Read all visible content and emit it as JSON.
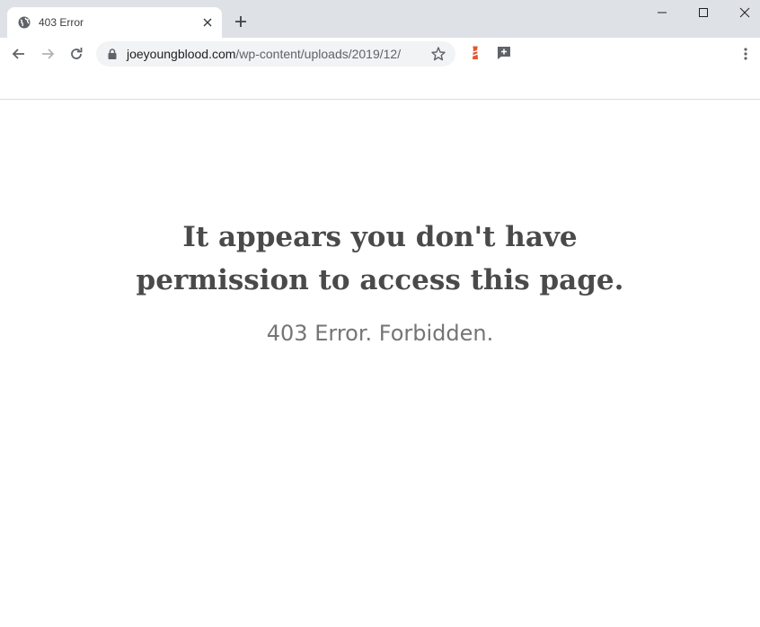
{
  "browser": {
    "tab": {
      "title": "403 Error",
      "favicon": "globe-icon"
    },
    "url": {
      "domain": "joeyoungblood.com",
      "path": "/wp-content/uploads/2019/12/"
    },
    "extensions": [
      {
        "name": "lighthouse-extension-icon",
        "color": "#e4572e"
      },
      {
        "name": "add-comment-extension-icon",
        "color": "#5f6368"
      }
    ],
    "colors": {
      "frame": "#dee1e6",
      "omnibox": "#f1f3f4"
    }
  },
  "page": {
    "headline_line1": "It appears you don't have",
    "headline_line2": "permission to access this page.",
    "subline": "403 Error. Forbidden."
  }
}
